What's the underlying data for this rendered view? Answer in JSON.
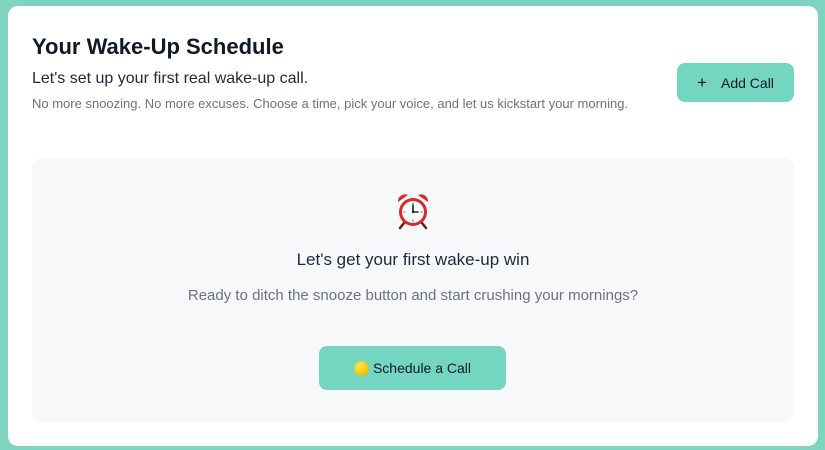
{
  "header": {
    "title": "Your Wake-Up Schedule",
    "subtitle": "Let's set up your first real wake-up call.",
    "description": "No more snoozing. No more excuses. Choose a time, pick your voice, and let us kickstart your morning."
  },
  "actions": {
    "add_call_icon": "plus-icon",
    "add_call_label": "Add Call"
  },
  "empty_state": {
    "icon": "alarm-clock-icon",
    "heading": "Let's get your first wake-up win",
    "text": "Ready to ditch the snooze button and start crushing your mornings?",
    "button_icon": "yellow-circle-icon",
    "button_label": "Schedule a Call"
  },
  "colors": {
    "background": "#7fd4bf",
    "accent": "#74d6c0",
    "card": "#ffffff",
    "panel": "#f7f8fa"
  }
}
